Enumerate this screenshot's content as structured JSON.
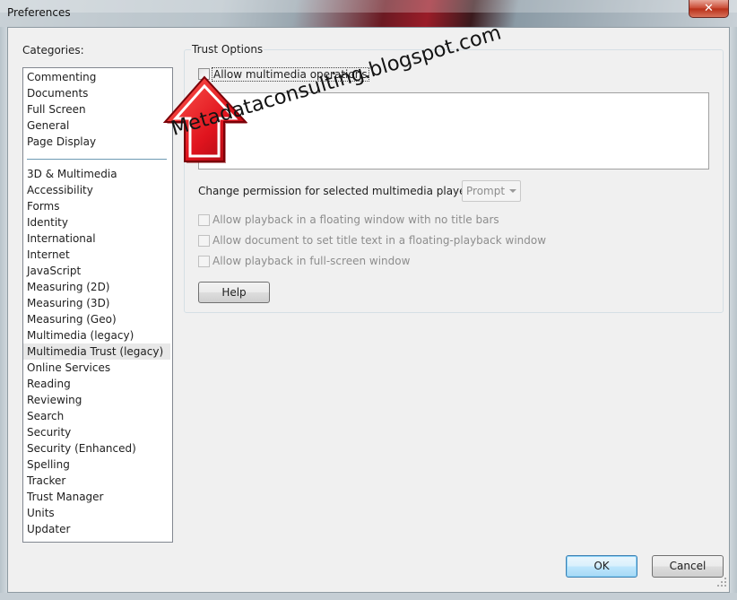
{
  "window": {
    "title": "Preferences",
    "close_glyph": "✕",
    "accent_close": "#c8462f"
  },
  "categories": {
    "label": "Categories:",
    "top_group": [
      "Commenting",
      "Documents",
      "Full Screen",
      "General",
      "Page Display"
    ],
    "items": [
      "3D & Multimedia",
      "Accessibility",
      "Forms",
      "Identity",
      "International",
      "Internet",
      "JavaScript",
      "Measuring (2D)",
      "Measuring (3D)",
      "Measuring (Geo)",
      "Multimedia (legacy)",
      "Multimedia Trust (legacy)",
      "Online Services",
      "Reading",
      "Reviewing",
      "Search",
      "Security",
      "Security (Enhanced)",
      "Spelling",
      "Tracker",
      "Trust Manager",
      "Units",
      "Updater"
    ],
    "selected": "Multimedia Trust (legacy)"
  },
  "trust_options": {
    "legend": "Trust Options",
    "allow_multimedia_label": "Allow multimedia operations",
    "allow_multimedia_checked": false,
    "change_permission_label": "Change permission for selected multimedia player to:",
    "permission_value": "Prompt",
    "options": [
      {
        "label": "Allow playback in a floating window with no title bars",
        "checked": false,
        "enabled": false
      },
      {
        "label": "Allow document to set title text in a floating-playback window",
        "checked": false,
        "enabled": false
      },
      {
        "label": "Allow playback in full-screen window",
        "checked": false,
        "enabled": false
      }
    ],
    "help_label": "Help"
  },
  "footer": {
    "ok_label": "OK",
    "cancel_label": "Cancel"
  },
  "overlay": {
    "watermark": "Metadataconsulting.blogspot.com",
    "arrow_color": "#e0141e",
    "arrow_icon": "red-up-arrow-icon"
  }
}
